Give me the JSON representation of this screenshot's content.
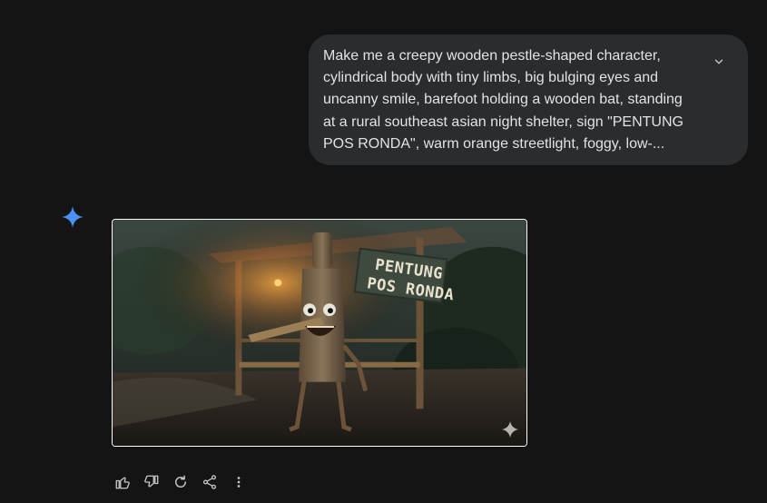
{
  "colors": {
    "background": "#141414",
    "bubble": "#2b2c2e",
    "text": "#e3e3e3",
    "accent_gem": "#4a90f5",
    "icon": "#c4c7c5"
  },
  "user_prompt": {
    "text": "Make me a creepy wooden pestle-shaped character, cylindrical body with tiny limbs, big bulging eyes and uncanny smile, barefoot holding a wooden bat, standing at a rural southeast asian night shelter, sign \"PENTUNG POS RONDA\", warm orange streetlight, foggy, low-...",
    "expand_icon": "chevron-down-icon"
  },
  "response": {
    "assistant_icon": "gemini-sparkle-icon",
    "image": {
      "sign_line_1": "PENTUNG",
      "sign_line_2": "POS RONDA",
      "watermark_icon": "sparkle-icon"
    },
    "actions": [
      {
        "name": "thumbs-up-icon"
      },
      {
        "name": "thumbs-down-icon"
      },
      {
        "name": "regenerate-icon"
      },
      {
        "name": "share-icon"
      },
      {
        "name": "more-vert-icon"
      }
    ]
  }
}
